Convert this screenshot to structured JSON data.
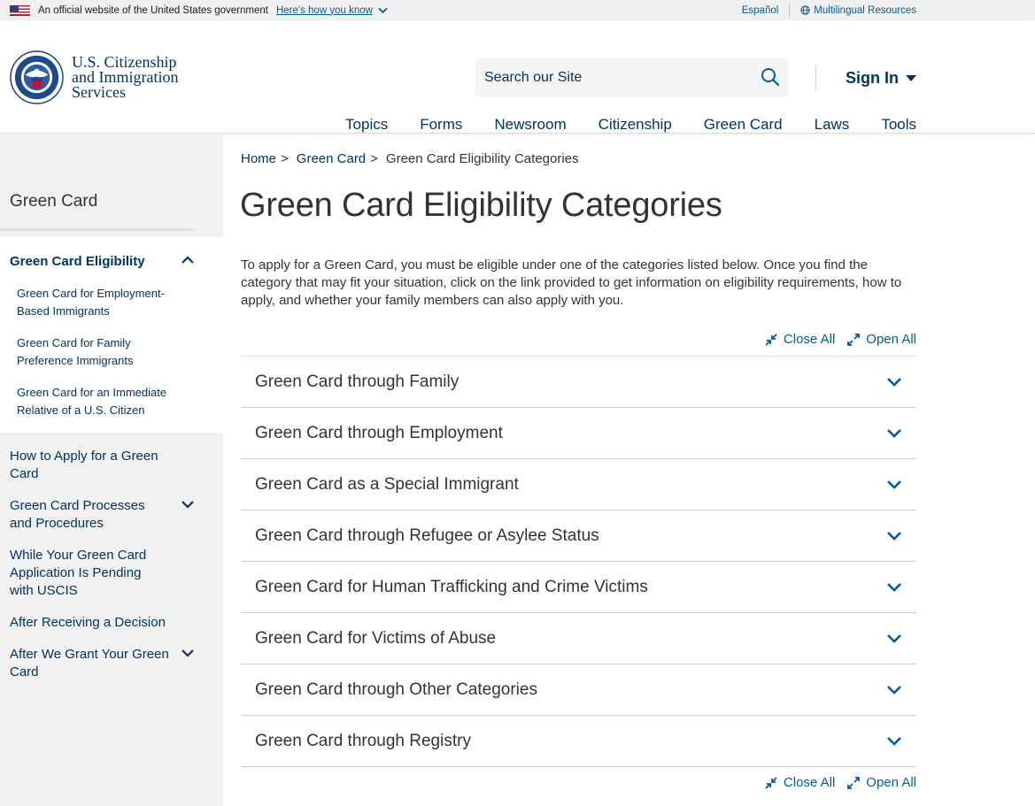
{
  "gov_banner": {
    "official_text": "An official website of the United States government",
    "how_you_know": "Here's how you know",
    "espanol": "Español",
    "multilingual": "Multilingual Resources"
  },
  "header": {
    "logo_line1": "U.S. Citizenship",
    "logo_line2": "and Immigration",
    "logo_line3": "Services",
    "search_placeholder": "Search our Site",
    "sign_in": "Sign In",
    "nav": [
      "Topics",
      "Forms",
      "Newsroom",
      "Citizenship",
      "Green Card",
      "Laws",
      "Tools"
    ]
  },
  "sidebar": {
    "title": "Green Card",
    "active_section": "Green Card Eligibility",
    "sub_items": [
      "Green Card for Employment-Based Immigrants",
      "Green Card for Family Preference Immigrants",
      "Green Card for an Immediate Relative of a U.S. Citizen"
    ],
    "items": [
      "How to Apply for a Green Card",
      "Green Card Processes and Procedures",
      "While Your Green Card Application Is Pending with USCIS",
      "After Receiving a Decision",
      "After We Grant Your Green Card"
    ]
  },
  "breadcrumb": {
    "home": "Home",
    "green_card": "Green Card",
    "current": "Green Card Eligibility Categories",
    "sep": ">"
  },
  "main": {
    "title": "Green Card Eligibility Categories",
    "intro": "To apply for a Green Card, you must be eligible under one of the categories listed below. Once you find the category that may fit your situation, click on the link provided to get information on eligibility requirements, how to apply, and whether your family members can also apply with you.",
    "close_all": "Close All",
    "open_all": "Open All",
    "accordion": [
      "Green Card through Family",
      "Green Card through Employment",
      "Green Card as a Special Immigrant",
      "Green Card through Refugee or Asylee Status",
      "Green Card for Human Trafficking and Crime Victims",
      "Green Card for Victims of Abuse",
      "Green Card through Other Categories",
      "Green Card through Registry"
    ]
  },
  "colors": {
    "navy": "#003366",
    "link": "#005ea2",
    "sidebar_bg": "#f1f1f1",
    "text": "#333333"
  }
}
